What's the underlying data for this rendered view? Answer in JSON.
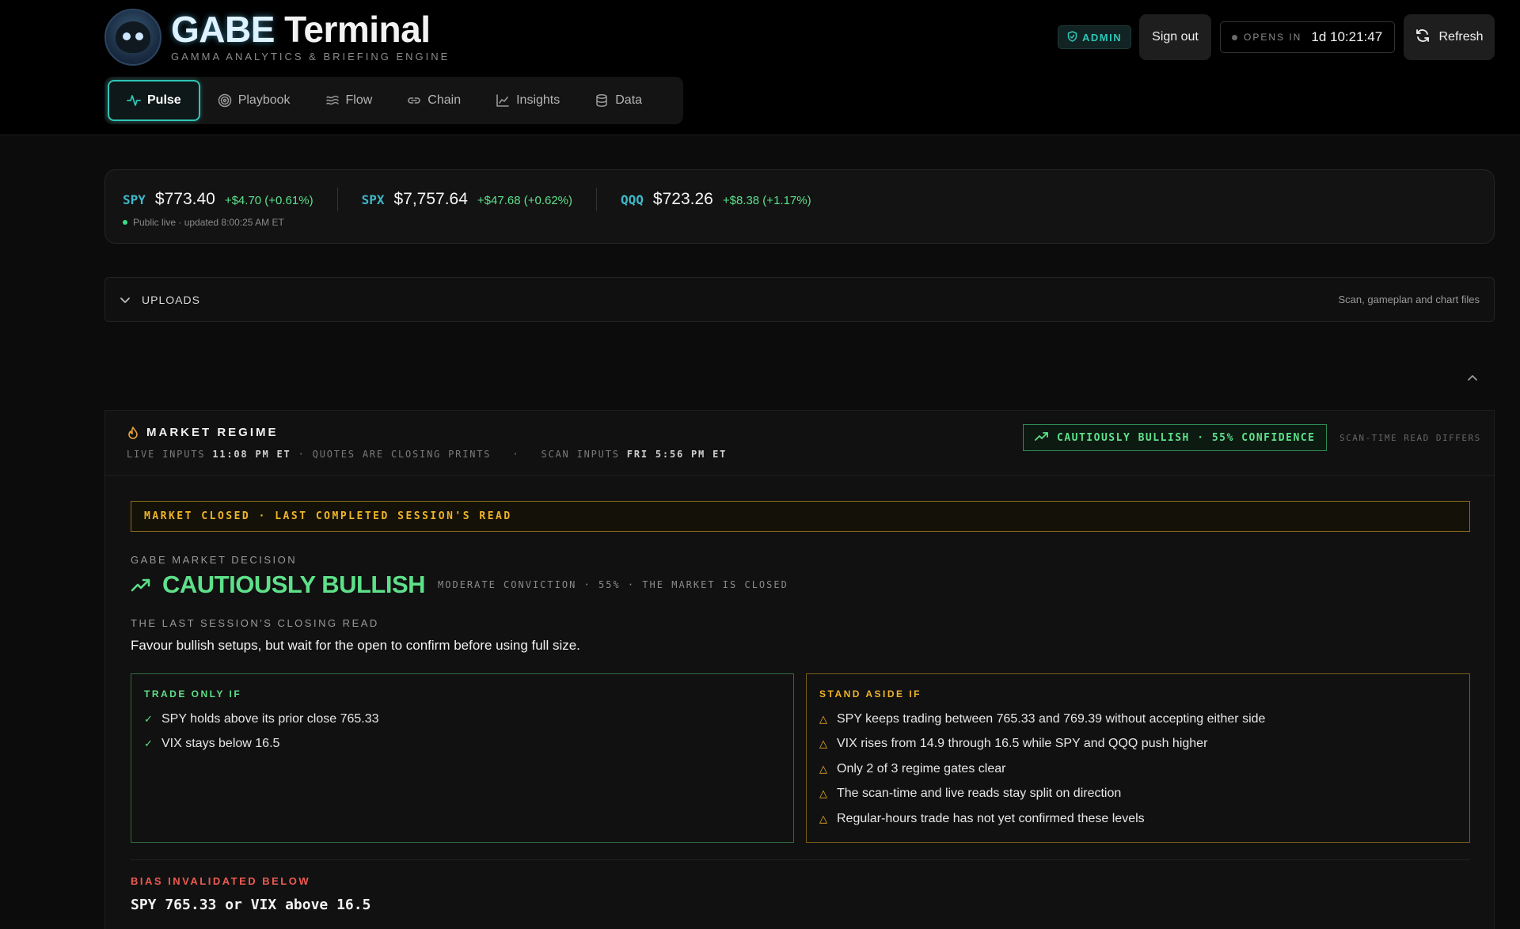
{
  "brand": {
    "title_accent": "GABE",
    "title_rest": " Terminal",
    "subtitle": "GAMMA ANALYTICS & BRIEFING ENGINE"
  },
  "nav": {
    "items": [
      {
        "label": "Pulse",
        "icon": "pulse-icon",
        "active": true
      },
      {
        "label": "Playbook",
        "icon": "target-icon",
        "active": false
      },
      {
        "label": "Flow",
        "icon": "waves-icon",
        "active": false
      },
      {
        "label": "Chain",
        "icon": "link-icon",
        "active": false
      },
      {
        "label": "Insights",
        "icon": "line-chart-icon",
        "active": false
      },
      {
        "label": "Data",
        "icon": "database-icon",
        "active": false
      }
    ]
  },
  "header": {
    "admin_label": "ADMIN",
    "signout_label": "Sign out",
    "opens_label": "OPENS IN",
    "opens_time": "1d 10:21:47",
    "refresh_label": "Refresh"
  },
  "quotes": {
    "items": [
      {
        "symbol": "SPY",
        "price": "$773.40",
        "change": "+$4.70 (+0.61%)"
      },
      {
        "symbol": "SPX",
        "price": "$7,757.64",
        "change": "+$47.68 (+0.62%)"
      },
      {
        "symbol": "QQQ",
        "price": "$723.26",
        "change": "+$8.38 (+1.17%)"
      }
    ],
    "status": "Public live · updated 8:00:25 AM ET"
  },
  "uploads": {
    "title": "UPLOADS",
    "hint": "Scan, gameplan and chart files"
  },
  "regime": {
    "title": "MARKET REGIME",
    "live_label": "LIVE INPUTS",
    "live_time": "11:08 PM ET",
    "quotes_note": "· QUOTES ARE CLOSING PRINTS",
    "scan_label": "SCAN INPUTS",
    "scan_time": "FRI 5:56 PM ET",
    "badge": "CAUTIOUSLY BULLISH · 55% CONFIDENCE",
    "differs": "SCAN-TIME READ DIFFERS",
    "banner": "MARKET CLOSED · LAST COMPLETED SESSION'S READ",
    "decision_label": "GABE MARKET DECISION",
    "decision_value": "CAUTIOUSLY BULLISH",
    "decision_meta": "MODERATE CONVICTION · 55% · THE MARKET IS CLOSED",
    "closing_label": "THE LAST SESSION'S CLOSING READ",
    "closing_text": "Favour bullish setups, but wait for the open to confirm before using full size.",
    "trade_title": "TRADE ONLY IF",
    "trade_items": [
      "SPY holds above its prior close 765.33",
      "VIX stays below 16.5"
    ],
    "aside_title": "STAND ASIDE IF",
    "aside_items": [
      "SPY keeps trading between 765.33 and 769.39 without accepting either side",
      "VIX rises from 14.9 through 16.5 while SPY and QQQ push higher",
      "Only 2 of 3 regime gates clear",
      "The scan-time and live reads stay split on direction",
      "Regular-hours trade has not yet confirmed these levels"
    ],
    "invalid_label": "BIAS INVALIDATED BELOW",
    "invalid_value": "SPY 765.33 or VIX above 16.5"
  },
  "colors": {
    "accent_teal": "#2ec4b6",
    "bullish_green": "#5ee08a",
    "warning_amber": "#f0b429",
    "danger_red": "#ee5a52"
  }
}
